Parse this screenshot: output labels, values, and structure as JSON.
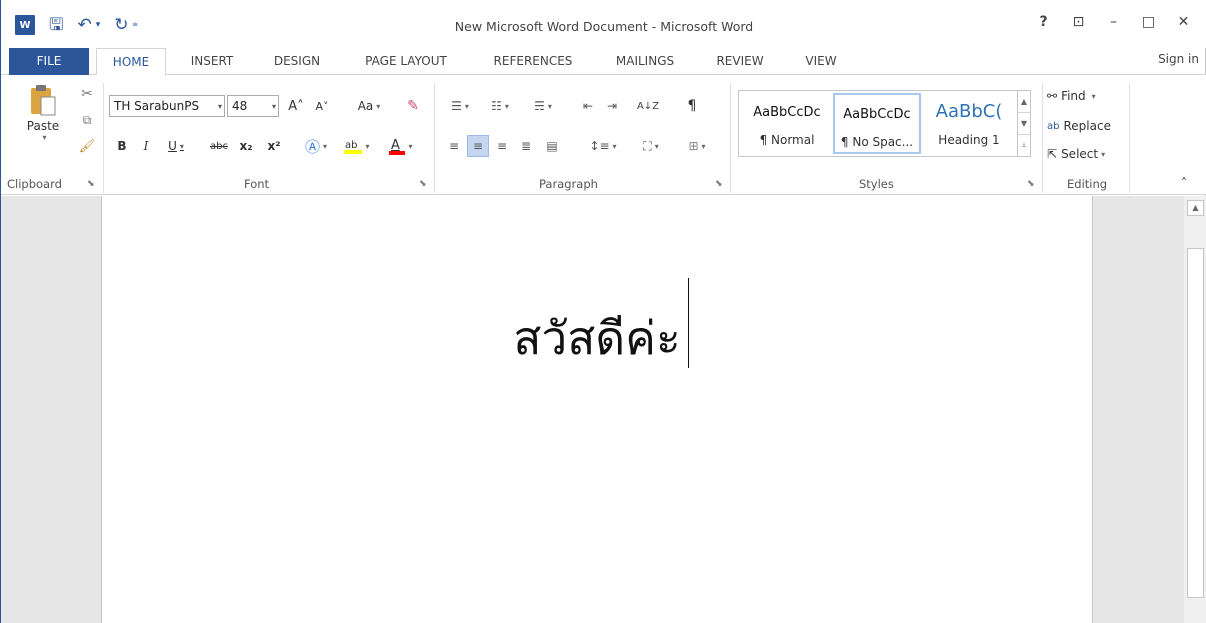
{
  "window": {
    "title": "New Microsoft Word Document - Microsoft Word",
    "app_icon_label": "W",
    "help": "?",
    "ribbon_display": "⊡",
    "minimize": "–",
    "maximize": "□",
    "close": "✕"
  },
  "qat": {
    "save": "🖫",
    "undo": "↶",
    "undo_drop": "▾",
    "redo": "↻",
    "customize": "⩧"
  },
  "tabs": [
    "FILE",
    "HOME",
    "INSERT",
    "DESIGN",
    "PAGE LAYOUT",
    "REFERENCES",
    "MAILINGS",
    "REVIEW",
    "VIEW"
  ],
  "signin": "Sign in",
  "clipboard": {
    "paste": "Paste",
    "group": "Clipboard"
  },
  "font": {
    "name": "TH SarabunPS",
    "size": "48",
    "case_label": "Aa",
    "group": "Font",
    "bold": "B",
    "italic": "I",
    "underline": "U",
    "strike": "abc",
    "sub": "x₂",
    "sup": "x²",
    "grow": "A˄",
    "shrink": "A˅"
  },
  "paragraph": {
    "group": "Paragraph",
    "sort": "A↓Z",
    "pilcrow": "¶"
  },
  "styles": {
    "group": "Styles",
    "items": [
      {
        "preview": "AaBbCcDc",
        "name": "¶ Normal"
      },
      {
        "preview": "AaBbCcDc",
        "name": "¶ No Spac..."
      },
      {
        "preview": "AaBbC(",
        "name": "Heading 1"
      }
    ]
  },
  "editing": {
    "group": "Editing",
    "find": "Find",
    "replace": "Replace",
    "select": "Select"
  },
  "collapse": "˄",
  "document": {
    "text": "สวัสดีค่ะ"
  },
  "colors": {
    "accent": "#2b579a",
    "highlight": "#ffff00",
    "font_color": "#ff0000"
  }
}
